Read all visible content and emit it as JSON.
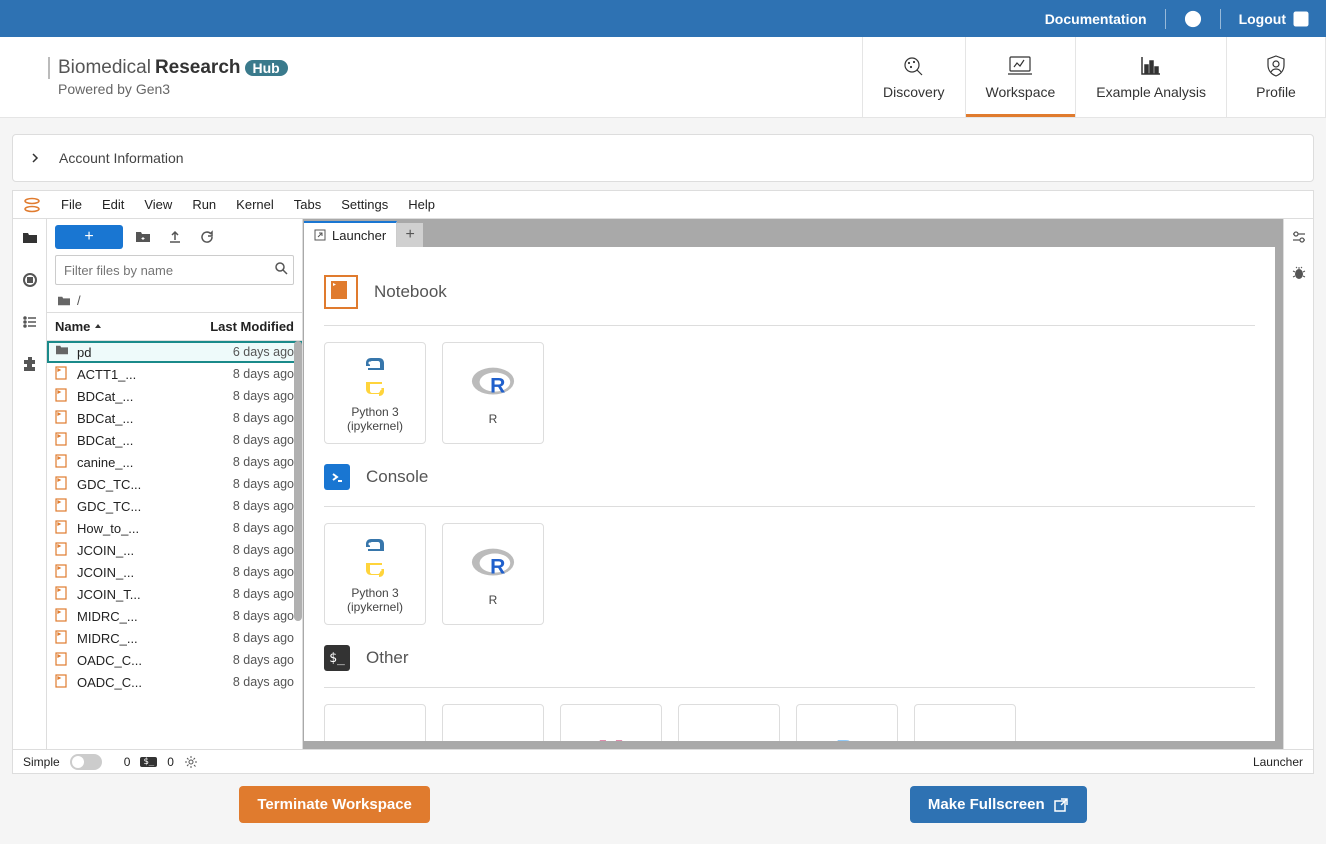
{
  "topbar": {
    "doc": "Documentation",
    "logout": "Logout"
  },
  "brand": {
    "pre": "Biomedical",
    "bold": "Research",
    "hub": "Hub",
    "sub": "Powered by Gen3"
  },
  "nav": {
    "discovery": "Discovery",
    "workspace": "Workspace",
    "example": "Example Analysis",
    "profile": "Profile"
  },
  "account_bar": "Account Information",
  "jp_menu": {
    "file": "File",
    "edit": "Edit",
    "view": "View",
    "run": "Run",
    "kernel": "Kernel",
    "tabs": "Tabs",
    "settings": "Settings",
    "help": "Help"
  },
  "fb": {
    "filter_placeholder": "Filter files by name",
    "root": "/",
    "col_name": "Name",
    "col_mod": "Last Modified",
    "files": [
      {
        "name": "pd",
        "mod": "6 days ago",
        "type": "folder",
        "selected": true
      },
      {
        "name": "ACTT1_...",
        "mod": "8 days ago",
        "type": "nb"
      },
      {
        "name": "BDCat_...",
        "mod": "8 days ago",
        "type": "nb"
      },
      {
        "name": "BDCat_...",
        "mod": "8 days ago",
        "type": "nb"
      },
      {
        "name": "BDCat_...",
        "mod": "8 days ago",
        "type": "nb"
      },
      {
        "name": "canine_...",
        "mod": "8 days ago",
        "type": "nb"
      },
      {
        "name": "GDC_TC...",
        "mod": "8 days ago",
        "type": "nb"
      },
      {
        "name": "GDC_TC...",
        "mod": "8 days ago",
        "type": "nb"
      },
      {
        "name": "How_to_...",
        "mod": "8 days ago",
        "type": "nb"
      },
      {
        "name": "JCOIN_...",
        "mod": "8 days ago",
        "type": "nb"
      },
      {
        "name": "JCOIN_...",
        "mod": "8 days ago",
        "type": "nb"
      },
      {
        "name": "JCOIN_T...",
        "mod": "8 days ago",
        "type": "nb"
      },
      {
        "name": "MIDRC_...",
        "mod": "8 days ago",
        "type": "nb"
      },
      {
        "name": "MIDRC_...",
        "mod": "8 days ago",
        "type": "nb"
      },
      {
        "name": "OADC_C...",
        "mod": "8 days ago",
        "type": "nb"
      },
      {
        "name": "OADC_C...",
        "mod": "8 days ago",
        "type": "nb"
      }
    ]
  },
  "launcher": {
    "tab": "Launcher",
    "notebook": "Notebook",
    "console": "Console",
    "other": "Other",
    "py": "Python 3 (ipykernel)",
    "r": "R"
  },
  "status": {
    "simple": "Simple",
    "zero1": "0",
    "zero2": "0",
    "launcher": "Launcher"
  },
  "buttons": {
    "terminate": "Terminate Workspace",
    "fullscreen": "Make Fullscreen"
  }
}
